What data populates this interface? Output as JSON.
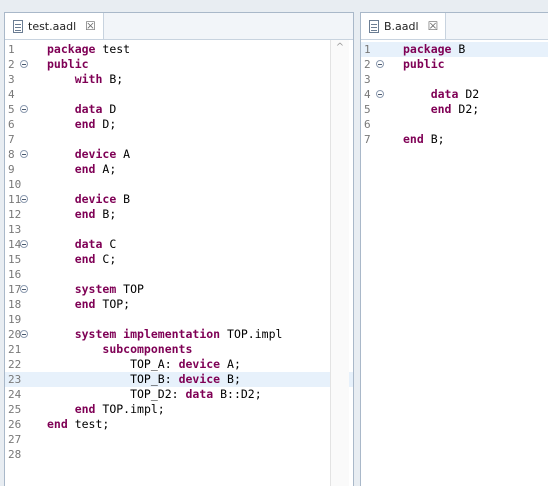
{
  "tabs": {
    "left": {
      "label": "test.aadl"
    },
    "right": {
      "label": "B.aadl"
    }
  },
  "close_glyph": "☒",
  "scroll_up_glyph": "^",
  "editor_left": {
    "lines": [
      {
        "n": "1",
        "parts": [
          {
            "t": "package",
            "k": true
          },
          {
            "t": " test"
          }
        ]
      },
      {
        "n": "2",
        "fold": true,
        "parts": [
          {
            "t": "public",
            "k": true
          }
        ]
      },
      {
        "n": "3",
        "parts": [
          {
            "t": "    "
          },
          {
            "t": "with",
            "k": true
          },
          {
            "t": " B;"
          }
        ]
      },
      {
        "n": "4",
        "parts": []
      },
      {
        "n": "5",
        "fold": true,
        "parts": [
          {
            "t": "    "
          },
          {
            "t": "data",
            "k": true
          },
          {
            "t": " D"
          }
        ]
      },
      {
        "n": "6",
        "parts": [
          {
            "t": "    "
          },
          {
            "t": "end",
            "k": true
          },
          {
            "t": " D;"
          }
        ]
      },
      {
        "n": "7",
        "parts": []
      },
      {
        "n": "8",
        "fold": true,
        "parts": [
          {
            "t": "    "
          },
          {
            "t": "device",
            "k": true
          },
          {
            "t": " A"
          }
        ]
      },
      {
        "n": "9",
        "parts": [
          {
            "t": "    "
          },
          {
            "t": "end",
            "k": true
          },
          {
            "t": " A;"
          }
        ]
      },
      {
        "n": "10",
        "parts": []
      },
      {
        "n": "11",
        "fold": true,
        "parts": [
          {
            "t": "    "
          },
          {
            "t": "device",
            "k": true
          },
          {
            "t": " B"
          }
        ]
      },
      {
        "n": "12",
        "parts": [
          {
            "t": "    "
          },
          {
            "t": "end",
            "k": true
          },
          {
            "t": " B;"
          }
        ]
      },
      {
        "n": "13",
        "parts": []
      },
      {
        "n": "14",
        "fold": true,
        "parts": [
          {
            "t": "    "
          },
          {
            "t": "data",
            "k": true
          },
          {
            "t": " C"
          }
        ]
      },
      {
        "n": "15",
        "parts": [
          {
            "t": "    "
          },
          {
            "t": "end",
            "k": true
          },
          {
            "t": " C;"
          }
        ]
      },
      {
        "n": "16",
        "parts": []
      },
      {
        "n": "17",
        "fold": true,
        "parts": [
          {
            "t": "    "
          },
          {
            "t": "system",
            "k": true
          },
          {
            "t": " TOP"
          }
        ]
      },
      {
        "n": "18",
        "parts": [
          {
            "t": "    "
          },
          {
            "t": "end",
            "k": true
          },
          {
            "t": " TOP;"
          }
        ]
      },
      {
        "n": "19",
        "parts": []
      },
      {
        "n": "20",
        "fold": true,
        "parts": [
          {
            "t": "    "
          },
          {
            "t": "system implementation",
            "k": true
          },
          {
            "t": " TOP.impl"
          }
        ]
      },
      {
        "n": "21",
        "parts": [
          {
            "t": "        "
          },
          {
            "t": "subcomponents",
            "k": true
          }
        ]
      },
      {
        "n": "22",
        "parts": [
          {
            "t": "            TOP_A: "
          },
          {
            "t": "device",
            "k": true
          },
          {
            "t": " A;"
          }
        ]
      },
      {
        "n": "23",
        "hl": true,
        "parts": [
          {
            "t": "            TOP_B: "
          },
          {
            "t": "device",
            "k": true
          },
          {
            "t": " B;"
          }
        ]
      },
      {
        "n": "24",
        "parts": [
          {
            "t": "            TOP_D2: "
          },
          {
            "t": "data",
            "k": true
          },
          {
            "t": " B::D2;"
          }
        ]
      },
      {
        "n": "25",
        "parts": [
          {
            "t": "    "
          },
          {
            "t": "end",
            "k": true
          },
          {
            "t": " TOP.impl;"
          }
        ]
      },
      {
        "n": "26",
        "parts": [
          {
            "t": "end",
            "k": true
          },
          {
            "t": " test;"
          }
        ]
      },
      {
        "n": "27",
        "parts": []
      },
      {
        "n": "28",
        "parts": []
      }
    ]
  },
  "editor_right": {
    "lines": [
      {
        "n": "1",
        "hl": true,
        "parts": [
          {
            "t": "package",
            "k": true
          },
          {
            "t": " B"
          }
        ]
      },
      {
        "n": "2",
        "fold": true,
        "parts": [
          {
            "t": "public",
            "k": true
          }
        ]
      },
      {
        "n": "3",
        "parts": []
      },
      {
        "n": "4",
        "fold": true,
        "parts": [
          {
            "t": "    "
          },
          {
            "t": "data",
            "k": true
          },
          {
            "t": " D2"
          }
        ]
      },
      {
        "n": "5",
        "parts": [
          {
            "t": "    "
          },
          {
            "t": "end",
            "k": true
          },
          {
            "t": " D2;"
          }
        ]
      },
      {
        "n": "6",
        "parts": []
      },
      {
        "n": "7",
        "parts": [
          {
            "t": "end",
            "k": true
          },
          {
            "t": " B;"
          }
        ]
      }
    ]
  }
}
